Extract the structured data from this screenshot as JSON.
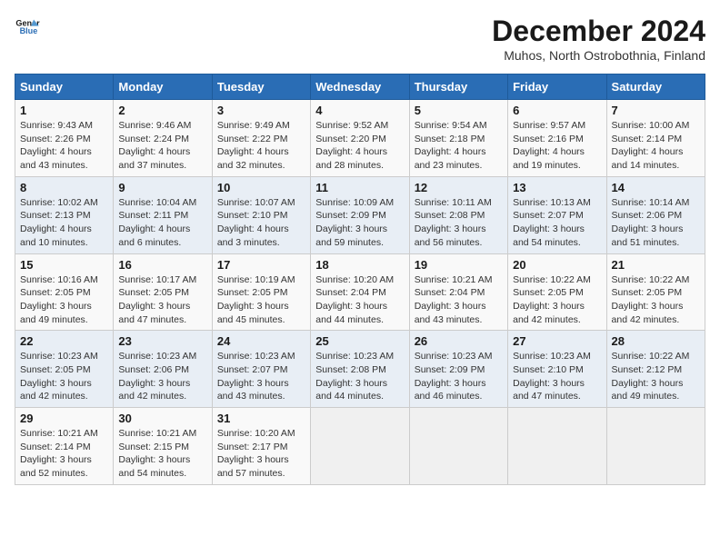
{
  "header": {
    "logo_line1": "General",
    "logo_line2": "Blue",
    "month_title": "December 2024",
    "subtitle": "Muhos, North Ostrobothnia, Finland"
  },
  "weekdays": [
    "Sunday",
    "Monday",
    "Tuesday",
    "Wednesday",
    "Thursday",
    "Friday",
    "Saturday"
  ],
  "weeks": [
    [
      {
        "day": "1",
        "detail": "Sunrise: 9:43 AM\nSunset: 2:26 PM\nDaylight: 4 hours\nand 43 minutes."
      },
      {
        "day": "2",
        "detail": "Sunrise: 9:46 AM\nSunset: 2:24 PM\nDaylight: 4 hours\nand 37 minutes."
      },
      {
        "day": "3",
        "detail": "Sunrise: 9:49 AM\nSunset: 2:22 PM\nDaylight: 4 hours\nand 32 minutes."
      },
      {
        "day": "4",
        "detail": "Sunrise: 9:52 AM\nSunset: 2:20 PM\nDaylight: 4 hours\nand 28 minutes."
      },
      {
        "day": "5",
        "detail": "Sunrise: 9:54 AM\nSunset: 2:18 PM\nDaylight: 4 hours\nand 23 minutes."
      },
      {
        "day": "6",
        "detail": "Sunrise: 9:57 AM\nSunset: 2:16 PM\nDaylight: 4 hours\nand 19 minutes."
      },
      {
        "day": "7",
        "detail": "Sunrise: 10:00 AM\nSunset: 2:14 PM\nDaylight: 4 hours\nand 14 minutes."
      }
    ],
    [
      {
        "day": "8",
        "detail": "Sunrise: 10:02 AM\nSunset: 2:13 PM\nDaylight: 4 hours\nand 10 minutes."
      },
      {
        "day": "9",
        "detail": "Sunrise: 10:04 AM\nSunset: 2:11 PM\nDaylight: 4 hours\nand 6 minutes."
      },
      {
        "day": "10",
        "detail": "Sunrise: 10:07 AM\nSunset: 2:10 PM\nDaylight: 4 hours\nand 3 minutes."
      },
      {
        "day": "11",
        "detail": "Sunrise: 10:09 AM\nSunset: 2:09 PM\nDaylight: 3 hours\nand 59 minutes."
      },
      {
        "day": "12",
        "detail": "Sunrise: 10:11 AM\nSunset: 2:08 PM\nDaylight: 3 hours\nand 56 minutes."
      },
      {
        "day": "13",
        "detail": "Sunrise: 10:13 AM\nSunset: 2:07 PM\nDaylight: 3 hours\nand 54 minutes."
      },
      {
        "day": "14",
        "detail": "Sunrise: 10:14 AM\nSunset: 2:06 PM\nDaylight: 3 hours\nand 51 minutes."
      }
    ],
    [
      {
        "day": "15",
        "detail": "Sunrise: 10:16 AM\nSunset: 2:05 PM\nDaylight: 3 hours\nand 49 minutes."
      },
      {
        "day": "16",
        "detail": "Sunrise: 10:17 AM\nSunset: 2:05 PM\nDaylight: 3 hours\nand 47 minutes."
      },
      {
        "day": "17",
        "detail": "Sunrise: 10:19 AM\nSunset: 2:05 PM\nDaylight: 3 hours\nand 45 minutes."
      },
      {
        "day": "18",
        "detail": "Sunrise: 10:20 AM\nSunset: 2:04 PM\nDaylight: 3 hours\nand 44 minutes."
      },
      {
        "day": "19",
        "detail": "Sunrise: 10:21 AM\nSunset: 2:04 PM\nDaylight: 3 hours\nand 43 minutes."
      },
      {
        "day": "20",
        "detail": "Sunrise: 10:22 AM\nSunset: 2:05 PM\nDaylight: 3 hours\nand 42 minutes."
      },
      {
        "day": "21",
        "detail": "Sunrise: 10:22 AM\nSunset: 2:05 PM\nDaylight: 3 hours\nand 42 minutes."
      }
    ],
    [
      {
        "day": "22",
        "detail": "Sunrise: 10:23 AM\nSunset: 2:05 PM\nDaylight: 3 hours\nand 42 minutes."
      },
      {
        "day": "23",
        "detail": "Sunrise: 10:23 AM\nSunset: 2:06 PM\nDaylight: 3 hours\nand 42 minutes."
      },
      {
        "day": "24",
        "detail": "Sunrise: 10:23 AM\nSunset: 2:07 PM\nDaylight: 3 hours\nand 43 minutes."
      },
      {
        "day": "25",
        "detail": "Sunrise: 10:23 AM\nSunset: 2:08 PM\nDaylight: 3 hours\nand 44 minutes."
      },
      {
        "day": "26",
        "detail": "Sunrise: 10:23 AM\nSunset: 2:09 PM\nDaylight: 3 hours\nand 46 minutes."
      },
      {
        "day": "27",
        "detail": "Sunrise: 10:23 AM\nSunset: 2:10 PM\nDaylight: 3 hours\nand 47 minutes."
      },
      {
        "day": "28",
        "detail": "Sunrise: 10:22 AM\nSunset: 2:12 PM\nDaylight: 3 hours\nand 49 minutes."
      }
    ],
    [
      {
        "day": "29",
        "detail": "Sunrise: 10:21 AM\nSunset: 2:14 PM\nDaylight: 3 hours\nand 52 minutes."
      },
      {
        "day": "30",
        "detail": "Sunrise: 10:21 AM\nSunset: 2:15 PM\nDaylight: 3 hours\nand 54 minutes."
      },
      {
        "day": "31",
        "detail": "Sunrise: 10:20 AM\nSunset: 2:17 PM\nDaylight: 3 hours\nand 57 minutes."
      },
      {
        "day": "",
        "detail": ""
      },
      {
        "day": "",
        "detail": ""
      },
      {
        "day": "",
        "detail": ""
      },
      {
        "day": "",
        "detail": ""
      }
    ]
  ]
}
